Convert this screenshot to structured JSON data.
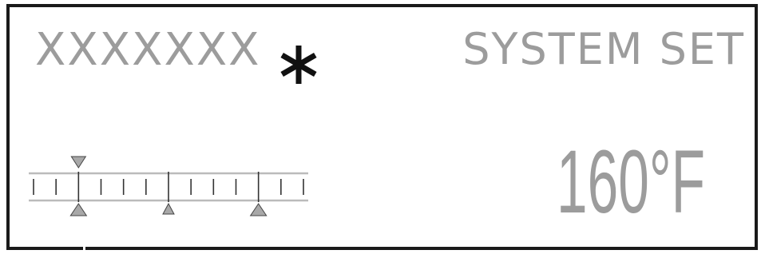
{
  "display": {
    "mode_label": "XXXXXXX",
    "star_icon": "asterisk-icon",
    "system_label": "SYSTEM SET",
    "temperature": "160°F",
    "colors": {
      "frame": "#1a1a1a",
      "text_dim": "#9c9c9c",
      "marker": "#a8a8a8",
      "marker_stroke": "#444444",
      "tick": "#333333"
    }
  },
  "scale": {
    "tick_count": 13,
    "major_ticks": [
      2,
      6,
      10
    ],
    "top_marker_tick": 2,
    "bottom_marker_ticks": [
      2,
      6,
      10
    ]
  }
}
